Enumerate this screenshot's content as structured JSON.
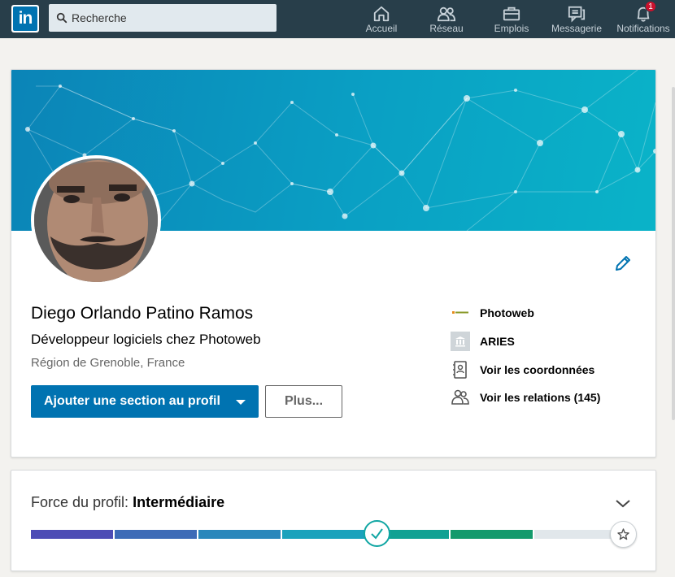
{
  "nav": {
    "logo_text": "in",
    "search_placeholder": "Recherche",
    "items": [
      {
        "label": "Accueil",
        "icon": "home-icon"
      },
      {
        "label": "Réseau",
        "icon": "network-icon"
      },
      {
        "label": "Emplois",
        "icon": "briefcase-icon"
      },
      {
        "label": "Messagerie",
        "icon": "messaging-icon"
      },
      {
        "label": "Notifications",
        "icon": "bell-icon",
        "badge": "1"
      }
    ]
  },
  "profile": {
    "name": "Diego Orlando Patino Ramos",
    "headline": "Développeur logiciels chez Photoweb",
    "location": "Région de Grenoble, France",
    "primary_action": "Ajouter une section au profil",
    "secondary_action": "Plus...",
    "sidebar": [
      {
        "label": "Photoweb",
        "icon": "company-logo-icon"
      },
      {
        "label": "ARIES",
        "icon": "school-icon"
      },
      {
        "label": "Voir les coordonnées",
        "icon": "contact-card-icon"
      },
      {
        "label": "Voir les relations (145)",
        "icon": "people-icon"
      }
    ]
  },
  "strength": {
    "label": "Force du profil:",
    "level": "Intermédiaire",
    "completed_segments": 6,
    "total_segments": 7,
    "colors": [
      "#4d4cb5",
      "#3d6bb7",
      "#2a87bb",
      "#1aa2bc",
      "#12a69a",
      "#0e9b7a",
      "#1a8f56",
      "#e1e7eb"
    ]
  }
}
